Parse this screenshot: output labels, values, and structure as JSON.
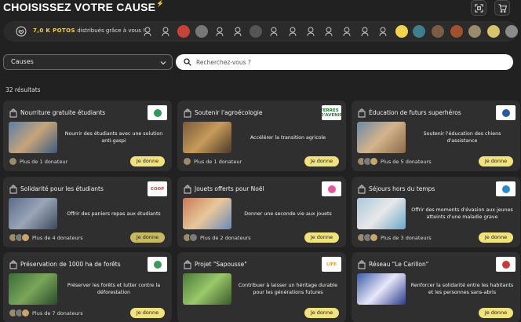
{
  "header": {
    "title": "CHOISISSEZ VOTRE CAUSE"
  },
  "donor_bar": {
    "count": "7,0 K POTOS",
    "suffix": "distribués grâce à vous !"
  },
  "filters": {
    "select_label": "Causes",
    "search_placeholder": "Recherchez-vous ?"
  },
  "results_label": "32 résultats",
  "give_label": "Je donne",
  "cards": [
    {
      "title": "Nourriture gratuite étudiants",
      "desc": "Nourrir des étudiants avec une solution anti-gaspi",
      "donors": "Plus de 1 donateur",
      "logo_text": ""
    },
    {
      "title": "Soutenir l'agroécologie",
      "desc": "Accélérer la transition agricole",
      "donors": "Plus de 1 donateur",
      "logo_text": "TERRES D'AVENIR"
    },
    {
      "title": "Éducation de futurs superhéros",
      "desc": "Soutenir l'éducation des chiens d'assistance",
      "donors": "Plus de 5 donateurs",
      "logo_text": ""
    },
    {
      "title": "Solidarité pour les étudiants",
      "desc": "Offrir des paniers repas aux étudiants",
      "donors": "Plus de 4 donateurs",
      "logo_text": "COOP"
    },
    {
      "title": "Jouets offerts pour Noël",
      "desc": "Donner une seconde vie aux jouets",
      "donors": "Plus de 2 donateurs",
      "logo_text": ""
    },
    {
      "title": "Séjours hors du temps",
      "desc": "Offrir des moments d'évasion aux jeunes atteints d'une maladie grave",
      "donors": "Plus de 3 donateurs",
      "logo_text": ""
    },
    {
      "title": "Préservation de 1000 ha de forêts",
      "desc": "Préserver les forêts et lutter contre la déforestation",
      "donors": "Plus de 7 donateurs",
      "logo_text": ""
    },
    {
      "title": "Projet \"Sapousse\"",
      "desc": "Contribuer à laisser un héritage durable pour les générations futures",
      "donors": "",
      "logo_text": "LIFE"
    },
    {
      "title": "Réseau \"Le Carillon\"",
      "desc": "Renforcer la solidarité entre les habitants et les personnes sans-abris",
      "donors": "",
      "logo_text": ""
    }
  ],
  "colors": {
    "background": "#212121",
    "card": "#2f2f2f",
    "accent": "#f2e27a"
  }
}
